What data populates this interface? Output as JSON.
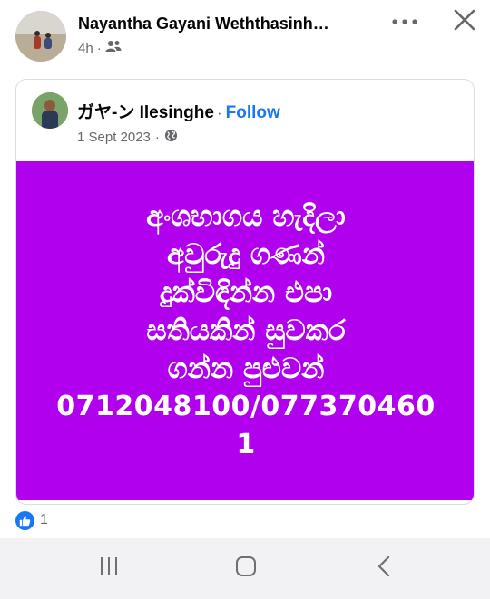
{
  "post": {
    "author": "Nayantha Gayani Weththasinh…",
    "time": "4h",
    "separator": "·",
    "audience_icon": "friends-icon",
    "actions": {
      "more_icon": "more-horizontal-icon",
      "close_icon": "close-icon"
    }
  },
  "shared_post": {
    "author": "ガヤ-ン Ilesinghe",
    "follow_separator": "·",
    "follow_label": "Follow",
    "date": "1 Sept 2023",
    "separator": "·",
    "audience_icon": "globe-icon",
    "image": {
      "background_color": "#b000ee",
      "lines": [
        "අංශභාගය හැදිලා",
        "අවුරුදු ගණන්",
        "දුක්විඳින්න එපා",
        "සතියකින් සුවකර",
        "ගන්න පුළුවන්"
      ],
      "phone_line_1": "0712048100/077370460",
      "phone_line_2": "1"
    }
  },
  "reactions": {
    "icon": "like-icon",
    "count": "1"
  },
  "system_nav": {
    "recents_icon": "recents-icon",
    "home_icon": "home-icon",
    "back_icon": "back-icon"
  },
  "colors": {
    "accent": "#1877f2",
    "secondary_text": "#65676b",
    "image_background": "#b000ee"
  }
}
